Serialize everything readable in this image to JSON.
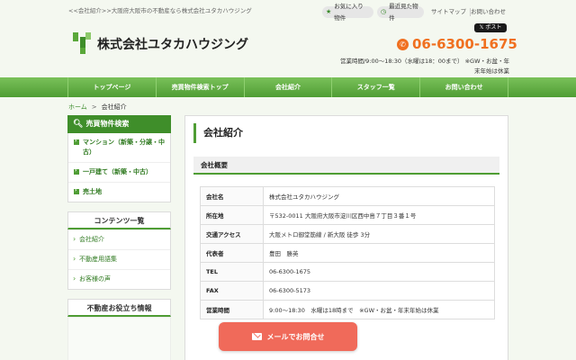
{
  "header": {
    "tagline": "<<会社紹介>>大阪府大阪市の不動産なら株式会社ユタカハウジング",
    "favorites_label": "お気に入り物件",
    "recent_label": "最近見た物件",
    "sitemap_label": "サイトマップ",
    "contact_label": "お問い合わせ",
    "post_label": "ポスト",
    "company_name": "株式会社ユタカハウジング",
    "phone": "06-6300-1675",
    "hours_line1": "営業時間/9:00～18:30（水曜は18：00まで） ※GW・お盆・年",
    "hours_line2": "末年始は休業",
    "brand_color": "#4f9d34",
    "accent_color": "#f07020"
  },
  "nav": {
    "items": [
      {
        "label": "トップページ"
      },
      {
        "label": "売買物件検索トップ"
      },
      {
        "label": "会社紹介"
      },
      {
        "label": "スタッフ一覧"
      },
      {
        "label": "お問い合わせ"
      }
    ]
  },
  "breadcrumb": {
    "home": "ホーム",
    "sep": ">",
    "current": "会社紹介"
  },
  "sidebar": {
    "search_title": "売買物件検索",
    "search_items": [
      {
        "label": "マンション（新築・分譲・中古）"
      },
      {
        "label": "一戸建て（新築・中古）"
      },
      {
        "label": "売土地"
      }
    ],
    "contents_title": "コンテンツ一覧",
    "contents_items": [
      {
        "label": "会社紹介"
      },
      {
        "label": "不動産用語集"
      },
      {
        "label": "お客様の声"
      }
    ],
    "next_title": "不動産お役立ち情報"
  },
  "main": {
    "title": "会社紹介",
    "section": "会社概要",
    "rows": [
      {
        "key": "会社名",
        "value": "株式会社ユタカハウジング"
      },
      {
        "key": "所在地",
        "value": "〒532-0011 大阪府大阪市淀川区西中島７丁目３番１号"
      },
      {
        "key": "交通アクセス",
        "value": "大阪メトロ御堂筋線 / 新大阪 徒歩 3分"
      },
      {
        "key": "代表者",
        "value": "豊田　勝英"
      },
      {
        "key": "TEL",
        "value": "06-6300-1675"
      },
      {
        "key": "FAX",
        "value": "06-6300-5173"
      },
      {
        "key": "営業時間",
        "value": "9:00～18:30　水曜は18時まで　※GW・お盆・年末年始は休業"
      }
    ]
  },
  "mail_button": {
    "label": "メールでお問合せ",
    "color": "#f06a5a"
  }
}
